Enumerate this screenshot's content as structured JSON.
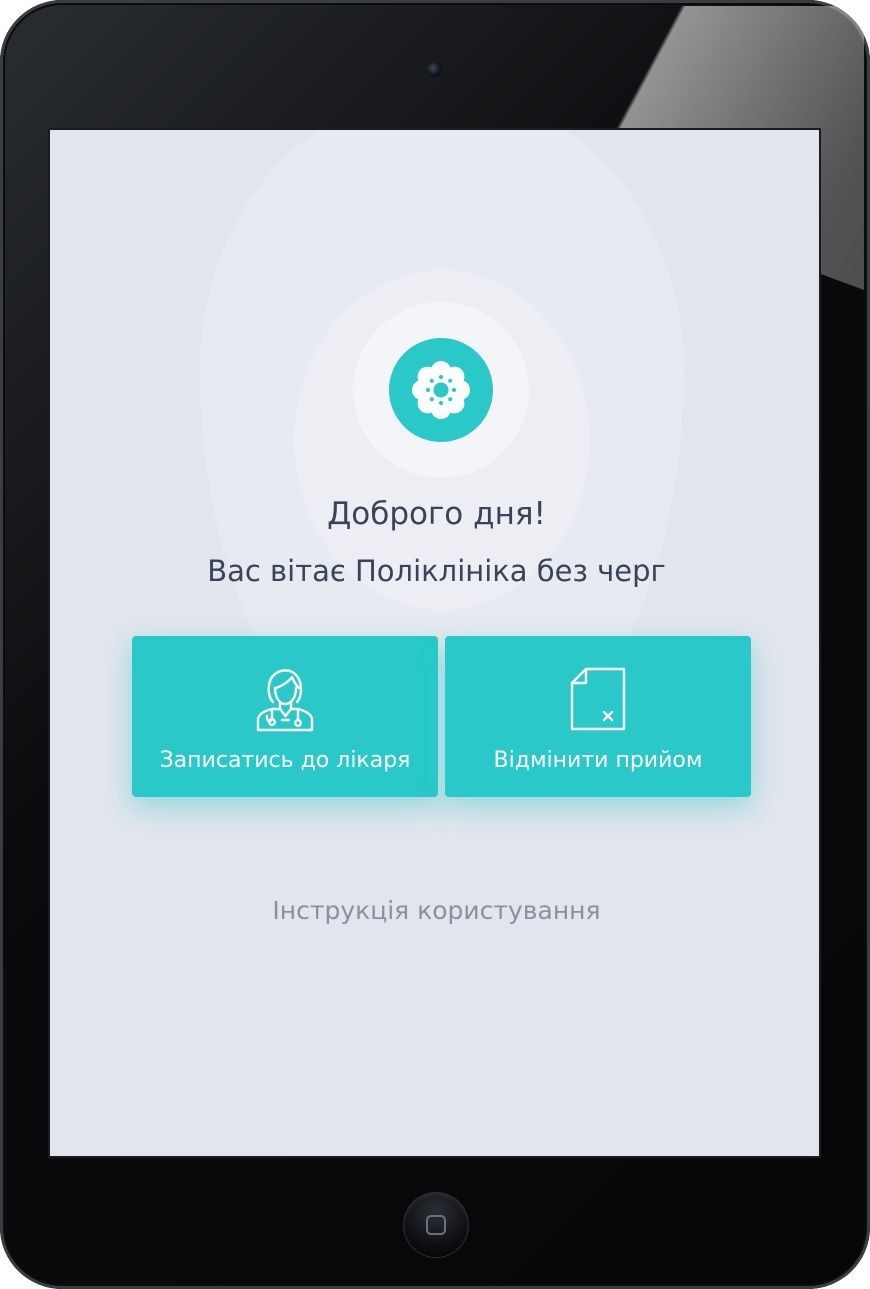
{
  "greeting": {
    "title": "Доброго дня!",
    "subtitle": "Вас вітає Поліклініка без черг"
  },
  "actions": {
    "book": {
      "label": "Записатись до лікаря",
      "icon": "doctor-icon"
    },
    "cancel": {
      "label": "Відмінити прийом",
      "icon": "cancel-document-icon"
    }
  },
  "links": {
    "manual": "Інструкція користування"
  },
  "logo": {
    "icon": "flower-icon"
  },
  "colors": {
    "accent": "#2ac8c9",
    "background": "#e2e5ed",
    "heading_text": "#3a4358",
    "link_text": "#8a90a0"
  }
}
